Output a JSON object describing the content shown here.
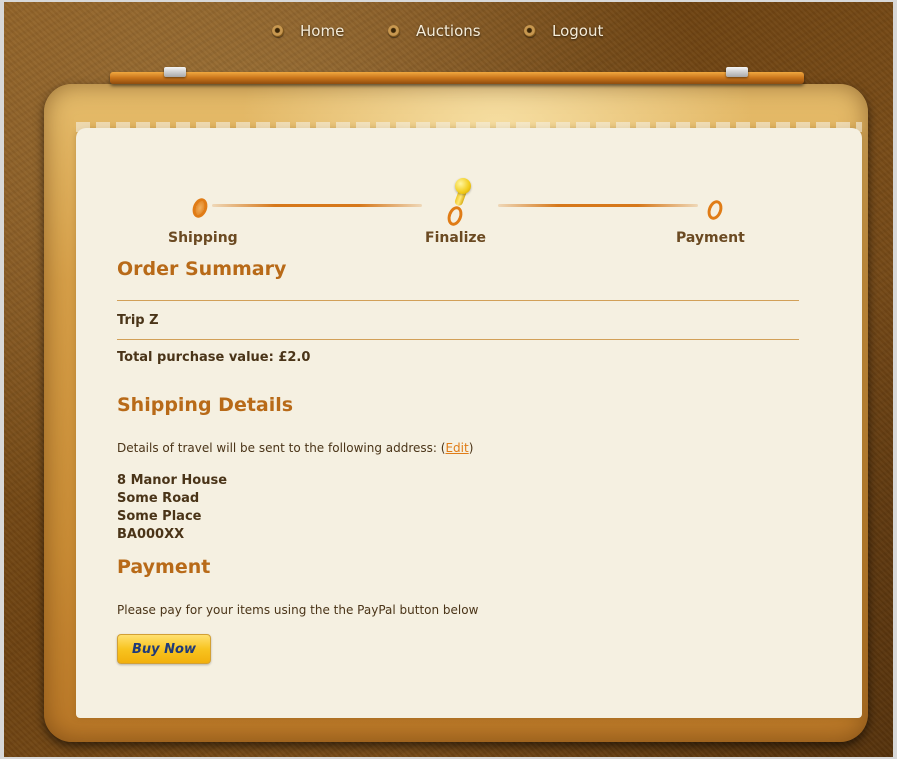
{
  "nav": {
    "items": [
      {
        "label": "Home"
      },
      {
        "label": "Auctions"
      },
      {
        "label": "Logout"
      }
    ]
  },
  "steps": [
    {
      "label": "Shipping"
    },
    {
      "label": "Finalize"
    },
    {
      "label": "Payment"
    }
  ],
  "order": {
    "heading": "Order Summary",
    "item": "Trip Z",
    "total": "Total purchase value: £2.0"
  },
  "shipping": {
    "heading": "Shipping Details",
    "intro": "Details of travel will be sent to the following address: (",
    "edit_label": "Edit",
    "intro_end": ")",
    "address": [
      "8 Manor House",
      "Some Road",
      "Some Place",
      "BA000XX"
    ]
  },
  "payment": {
    "heading": "Payment",
    "instructions": "Please pay for your items using the the PayPal button below",
    "button_label": "Buy Now"
  },
  "colors": {
    "accent": "#b86a18",
    "link": "#e07c16",
    "paper": "#f5f0e1"
  }
}
